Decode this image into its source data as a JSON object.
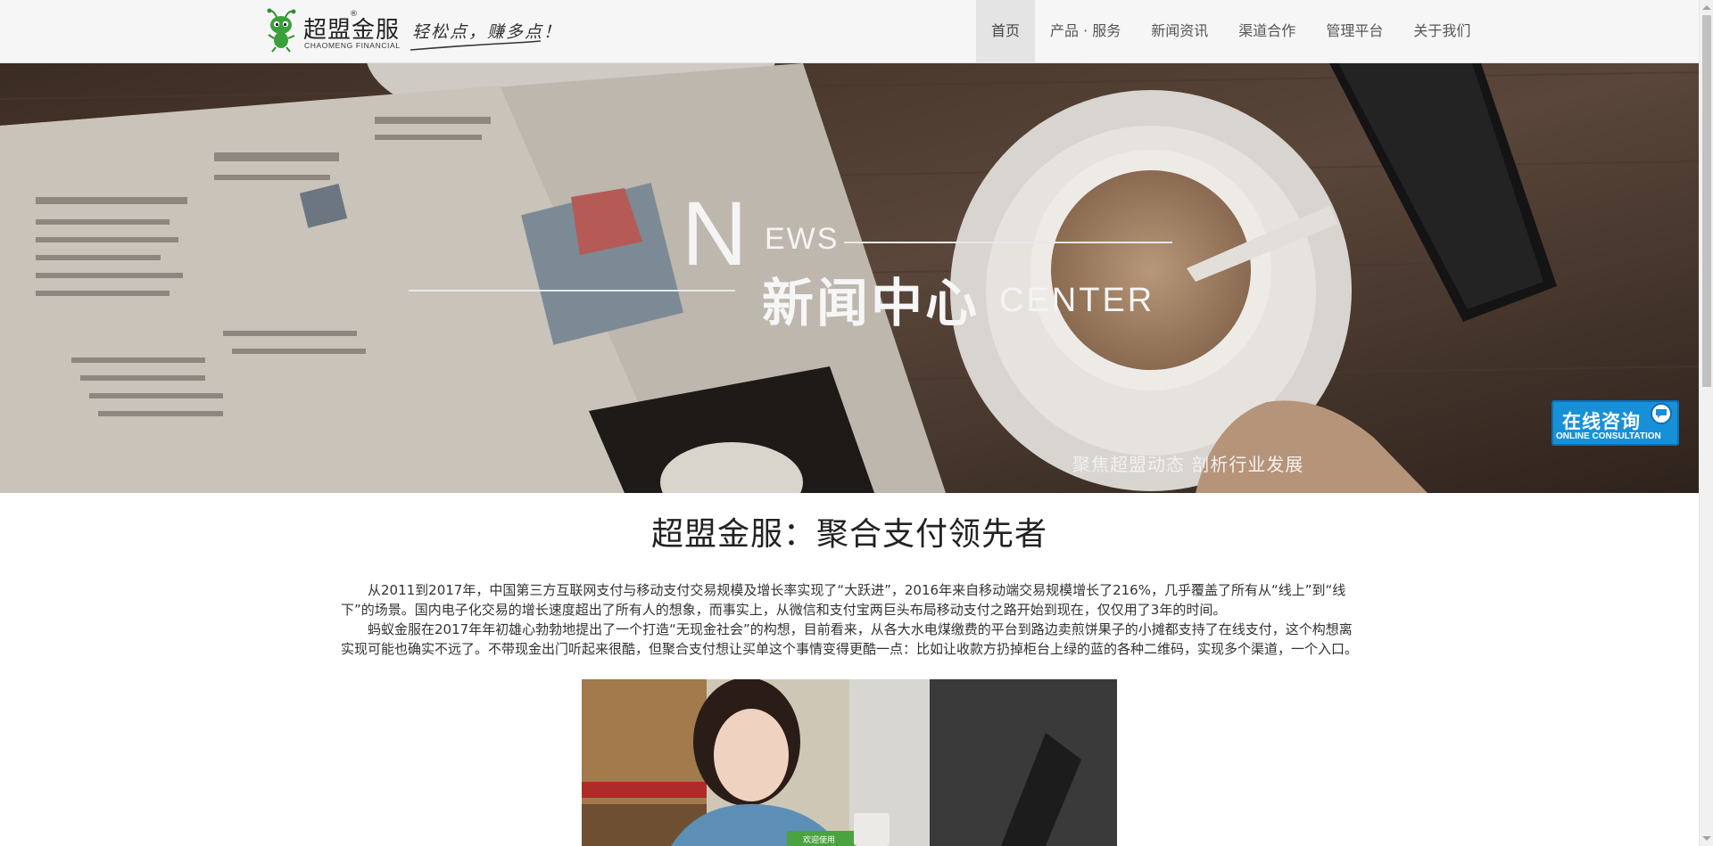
{
  "header": {
    "logo": {
      "name_cn": "超盟金服",
      "registered": "®",
      "name_en": "CHAOMENG FINANCIAL",
      "slogan": "轻松点，赚多点！"
    },
    "nav": [
      {
        "label": "首页",
        "active": true
      },
      {
        "label": "产品 · 服务",
        "active": false
      },
      {
        "label": "新闻资讯",
        "active": false
      },
      {
        "label": "渠道合作",
        "active": false
      },
      {
        "label": "管理平台",
        "active": false
      },
      {
        "label": "关于我们",
        "active": false
      }
    ]
  },
  "banner": {
    "big_letter": "N",
    "word_rest": "EWS",
    "title_cn": "新闻中心",
    "title_en": "CENTER",
    "subtitle": "聚焦超盟动态  剖析行业发展"
  },
  "consult": {
    "label_cn": "在线咨询",
    "label_en": "ONLINE CONSULTATION"
  },
  "article": {
    "title": "超盟金服：聚合支付领先者",
    "paragraphs": [
      "从2011到2017年，中国第三方互联网支付与移动支付交易规模及增长率实现了“大跃进”，2016年来自移动端交易规模增长了216%，几乎覆盖了所有从“线上”到“线下”的场景。国内电子化交易的增长速度超出了所有人的想象，而事实上，从微信和支付宝两巨头布局移动支付之路开始到现在，仅仅用了3年的时间。",
      "蚂蚁金服在2017年年初雄心勃勃地提出了一个打造“无现金社会”的构想，目前看来，从各大水电煤缴费的平台到路边卖煎饼果子的小摊都支持了在线支付，这个构想离实现可能也确实不远了。不带现金出门听起来很酷，但聚合支付想让买单这个事情变得更酷一点：比如让收款方扔掉柜台上绿的蓝的各种二维码，实现多个渠道，一个入口。"
    ],
    "photo_card_text": "欢迎使用"
  },
  "colors": {
    "header_bg": "#f6f6f6",
    "nav_active_bg": "#e4e4e4",
    "consult_blue": "#1890d8",
    "logo_green": "#3aa03a"
  }
}
